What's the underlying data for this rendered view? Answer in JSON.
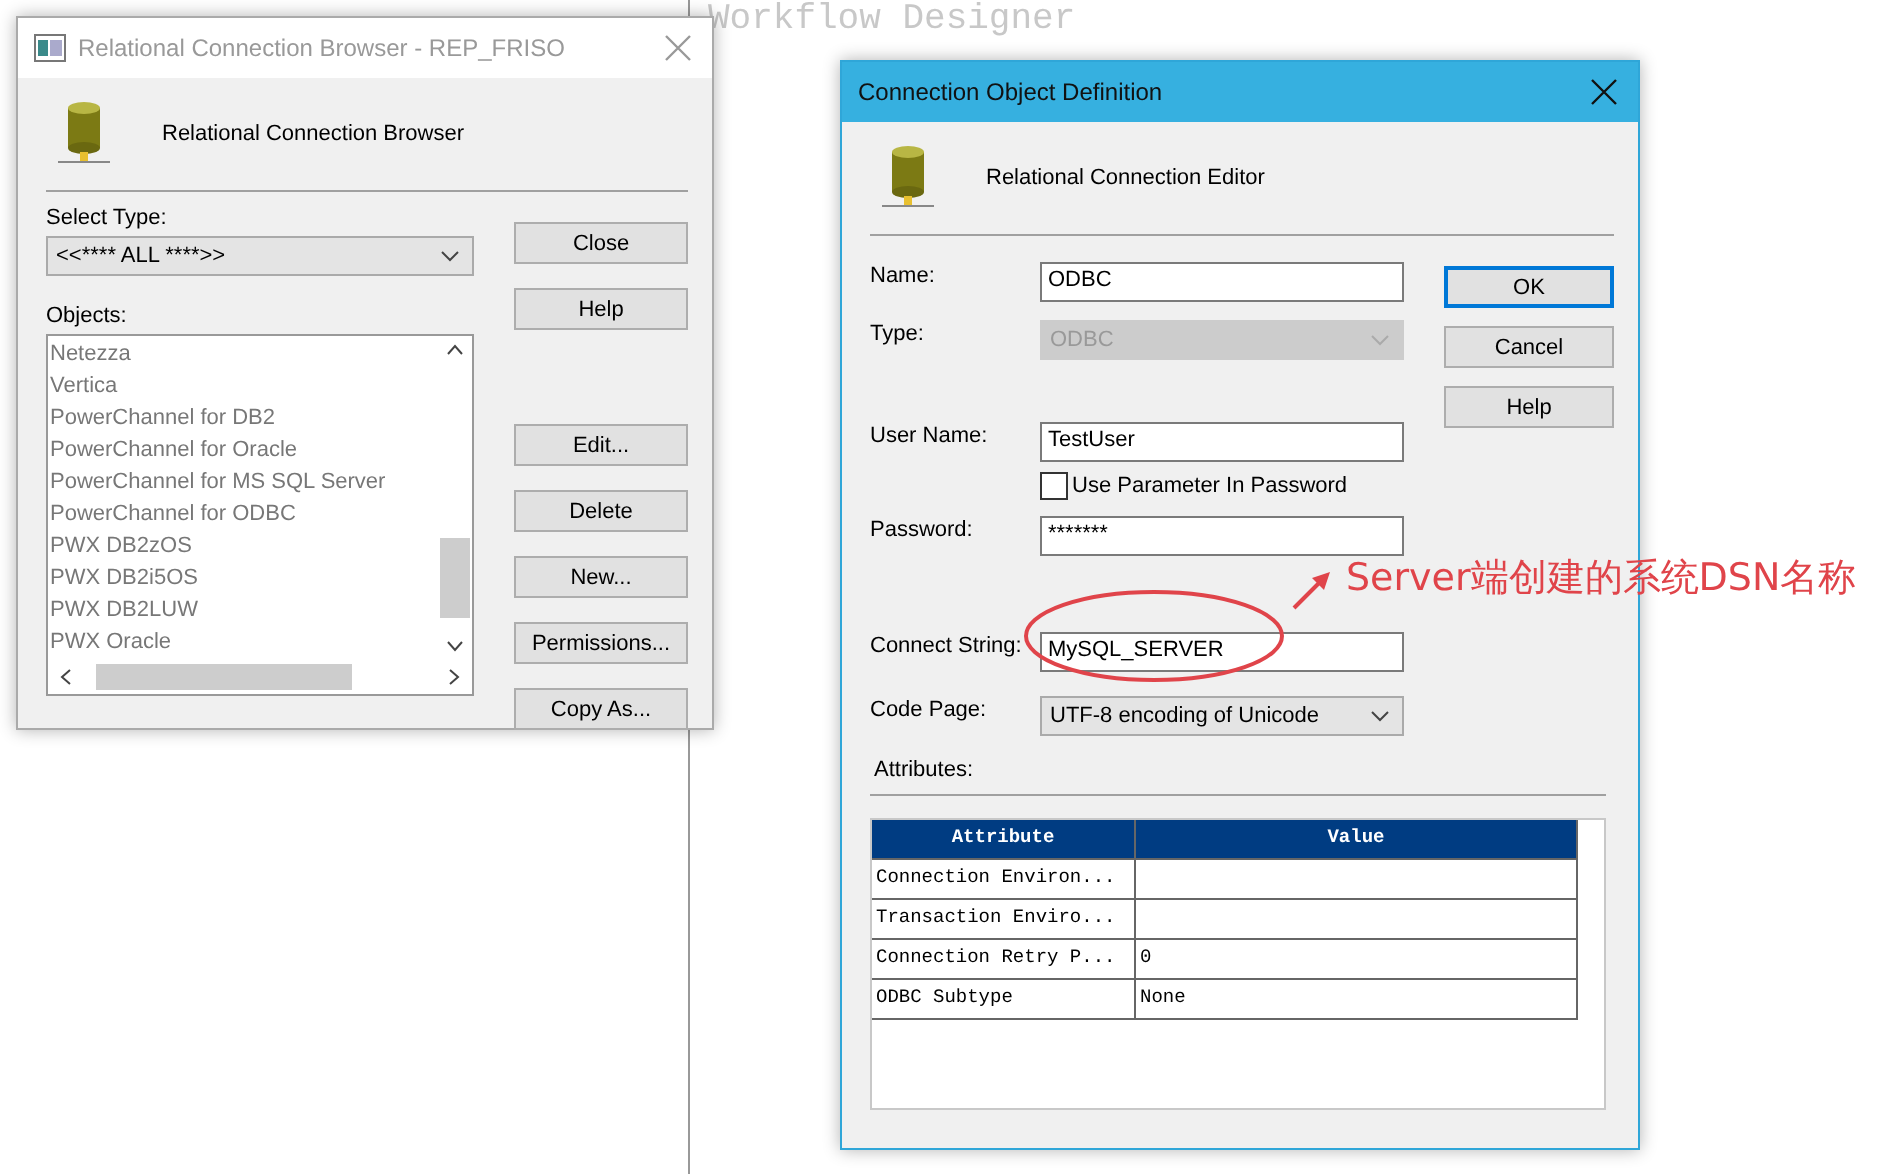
{
  "background": {
    "title": "Workflow Designer"
  },
  "browser": {
    "title": "Relational Connection Browser - REP_FRISO",
    "active": false,
    "heading": "Relational Connection Browser",
    "select_type": {
      "label": "Select Type:",
      "value": "<<**** ALL ****>>"
    },
    "objects": {
      "label": "Objects:",
      "items": [
        "Netezza",
        "Vertica",
        "PowerChannel for DB2",
        "PowerChannel for Oracle",
        "PowerChannel for MS SQL Server",
        "PowerChannel for ODBC",
        "PWX DB2zOS",
        "PWX DB2i5OS",
        "PWX DB2LUW",
        "PWX Oracle"
      ]
    },
    "buttons_top": [
      "Close",
      "Help"
    ],
    "buttons_bottom": [
      "Edit...",
      "Delete",
      "New...",
      "Permissions...",
      "Copy As..."
    ]
  },
  "editor": {
    "title": "Connection Object Definition",
    "active": true,
    "heading": "Relational Connection Editor",
    "fields": [
      {
        "kind": "text",
        "label": "Name:",
        "value": "ODBC"
      },
      {
        "kind": "select",
        "label": "Type:",
        "value": "ODBC",
        "disabled": true
      },
      {
        "kind": "text",
        "label": "User Name:",
        "value": "TestUser"
      },
      {
        "kind": "checkbox",
        "label": "Use Parameter In Password",
        "checked": false
      },
      {
        "kind": "text",
        "label": "Password:",
        "value": "*******"
      },
      {
        "kind": "text",
        "label": "Connect String:",
        "value": "MySQL_SERVER"
      },
      {
        "kind": "select",
        "label": "Code Page:",
        "value": "UTF-8 encoding of Unicode",
        "disabled": false
      }
    ],
    "attributes_label": "Attributes:",
    "table": {
      "columns": [
        "Attribute",
        "Value"
      ],
      "rows": [
        [
          "Connection Environ...",
          ""
        ],
        [
          "Transaction Enviro...",
          ""
        ],
        [
          "Connection Retry P...",
          "0"
        ],
        [
          "ODBC Subtype",
          "None"
        ]
      ]
    },
    "buttons": [
      {
        "label": "OK",
        "default": true
      },
      {
        "label": "Cancel",
        "default": false
      },
      {
        "label": "Help",
        "default": false
      }
    ]
  },
  "annotation": {
    "text": "Server端创建的系统DSN名称"
  }
}
